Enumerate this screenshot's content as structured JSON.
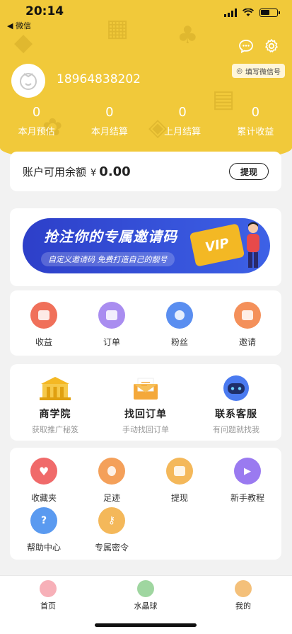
{
  "status_bar": {
    "time": "20:14",
    "back_app": "◀ 微信"
  },
  "header": {
    "wechat_button": "填写微信号",
    "phone": "18964838202",
    "stats": [
      {
        "value": "0",
        "label": "本月预估"
      },
      {
        "value": "0",
        "label": "本月结算"
      },
      {
        "value": "0",
        "label": "上月结算"
      },
      {
        "value": "0",
        "label": "累计收益"
      }
    ]
  },
  "balance": {
    "label": "账户可用余额",
    "currency": "¥",
    "amount": "0.00",
    "withdraw_label": "提现"
  },
  "banner": {
    "title": "抢注你的专属邀请码",
    "subtitle": "自定义邀请码 免费打造自己的靓号",
    "badge": "VIP"
  },
  "quick_actions": [
    {
      "label": "收益",
      "color": "#f0705a"
    },
    {
      "label": "订单",
      "color": "#a98df0"
    },
    {
      "label": "粉丝",
      "color": "#5a8ef0"
    },
    {
      "label": "邀请",
      "color": "#f4905a"
    }
  ],
  "services": [
    {
      "name": "商学院",
      "desc": "获取推广秘笈"
    },
    {
      "name": "找回订单",
      "desc": "手动找回订单"
    },
    {
      "name": "联系客服",
      "desc": "有问题就找我"
    }
  ],
  "tools": [
    {
      "label": "收藏夹",
      "color": "#f06a6a"
    },
    {
      "label": "足迹",
      "color": "#f4a05a"
    },
    {
      "label": "提现",
      "color": "#f4b85a"
    },
    {
      "label": "新手教程",
      "color": "#9a7af0"
    },
    {
      "label": "帮助中心",
      "color": "#5a9af0"
    },
    {
      "label": "专属密令",
      "color": "#f4b85a"
    }
  ],
  "tabbar": [
    {
      "label": "首页"
    },
    {
      "label": "水晶球"
    },
    {
      "label": "我的"
    }
  ]
}
